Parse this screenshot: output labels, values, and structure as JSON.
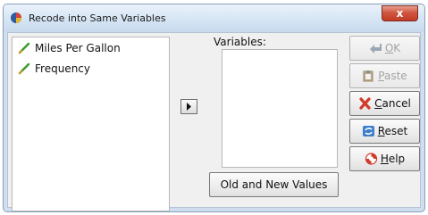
{
  "window": {
    "title": "Recode into Same Variables",
    "close_glyph": "x"
  },
  "variable_list": [
    {
      "label": "Miles Per Gallon",
      "icon": "scale-ruler-icon"
    },
    {
      "label": "Frequency",
      "icon": "scale-ruler-icon"
    }
  ],
  "target": {
    "label": "Variables:"
  },
  "buttons": {
    "old_new": "Old and New Values",
    "ok": {
      "underlined": "O",
      "rest": "K"
    },
    "paste": {
      "underlined": "P",
      "rest": "aste"
    },
    "cancel": {
      "underlined": "C",
      "rest": "ancel"
    },
    "reset": {
      "underlined": "R",
      "rest": "eset"
    },
    "help": {
      "underlined": "H",
      "rest": "elp"
    }
  },
  "colors": {
    "title_bar": "#d6e5f4",
    "close": "#c23b25",
    "scale_icon": "#3a9a2a"
  }
}
